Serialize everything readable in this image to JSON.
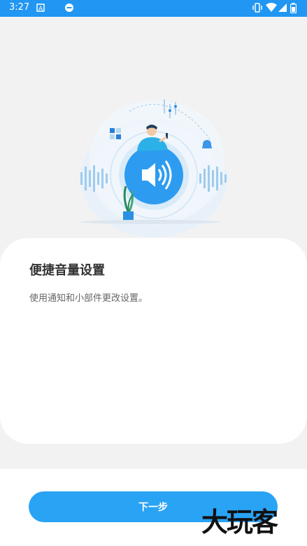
{
  "status_bar": {
    "time": "3:27",
    "left_icons": [
      "a-icon",
      "record-icon"
    ],
    "right_icons": [
      "vibrate-icon",
      "wifi-icon",
      "signal-icon",
      "battery-icon"
    ]
  },
  "card": {
    "title": "便捷音量设置",
    "description": "使用通知和小部件更改设置。"
  },
  "bottom": {
    "next_label": "下一步"
  },
  "watermark": "大玩客",
  "colors": {
    "accent": "#2196f3",
    "button": "#29a3f4"
  }
}
